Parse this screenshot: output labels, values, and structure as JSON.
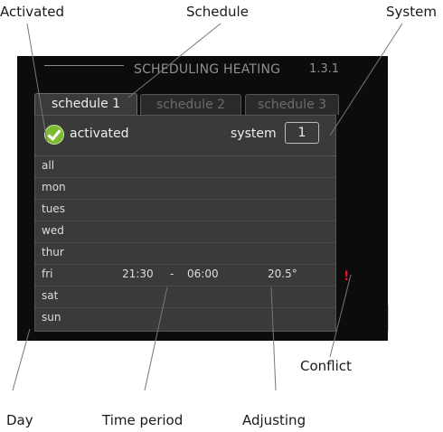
{
  "callouts": {
    "activated": "Activated",
    "schedule": "Schedule",
    "system": "System",
    "conflict": "Conflict",
    "day": "Day",
    "time_period": "Time period",
    "adjusting": "Adjusting"
  },
  "header": {
    "title": "SCHEDULING HEATING",
    "menu_number": "1.3.1"
  },
  "tabs": [
    {
      "label": "schedule 1",
      "active": true
    },
    {
      "label": "schedule 2",
      "active": false
    },
    {
      "label": "schedule 3",
      "active": false
    }
  ],
  "settings": {
    "activated_label": "activated",
    "activated": true,
    "system_label": "system",
    "system_value": "1"
  },
  "days": [
    {
      "day": "all",
      "start": "",
      "sep": "",
      "end": "",
      "temp": ""
    },
    {
      "day": "mon",
      "start": "",
      "sep": "",
      "end": "",
      "temp": ""
    },
    {
      "day": "tues",
      "start": "",
      "sep": "",
      "end": "",
      "temp": ""
    },
    {
      "day": "wed",
      "start": "",
      "sep": "",
      "end": "",
      "temp": ""
    },
    {
      "day": "thur",
      "start": "",
      "sep": "",
      "end": "",
      "temp": ""
    },
    {
      "day": "fri",
      "start": "21:30",
      "sep": "-",
      "end": "06:00",
      "temp": "20.5°"
    },
    {
      "day": "sat",
      "start": "",
      "sep": "",
      "end": "",
      "temp": ""
    },
    {
      "day": "sun",
      "start": "",
      "sep": "",
      "end": "",
      "temp": ""
    }
  ],
  "conflict_mark": "!",
  "help_glyph": "?",
  "icons": [
    "house-icon",
    "clock-icon",
    "thermometer-icon",
    "check-icon",
    "help-icon"
  ],
  "colors": {
    "screen_bg": "#0c0c0c",
    "panel_bg": "#3a3a3a",
    "accent_green": "#7dbb31",
    "conflict_red": "#e0141e"
  }
}
